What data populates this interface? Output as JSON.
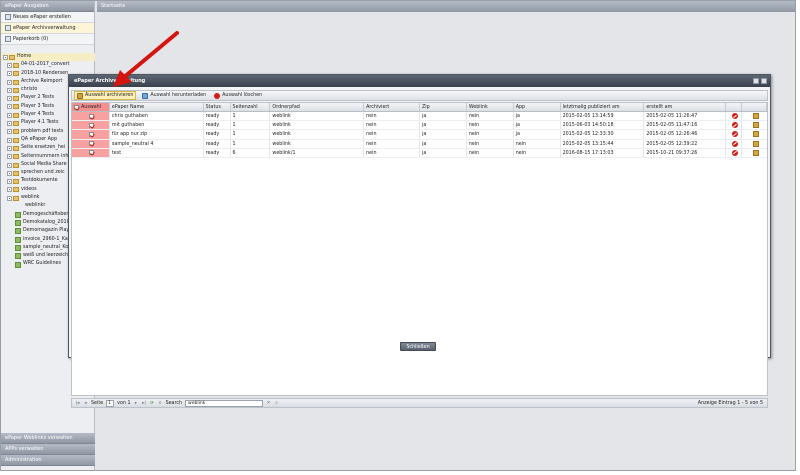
{
  "sidebar": {
    "top_header": "ePaper Ausgaben",
    "menu": [
      {
        "label": "Neues ePaper erstellen"
      },
      {
        "label": "ePaper Archivverwaltung"
      },
      {
        "label": "Papierkorb (0)"
      }
    ],
    "tree": [
      {
        "label": "Home",
        "type": "home"
      },
      {
        "label": "04-01-2017_convert",
        "type": "folder"
      },
      {
        "label": "2018-10 Rendersen",
        "type": "folder"
      },
      {
        "label": "Archive Reimport",
        "type": "folder"
      },
      {
        "label": "christo",
        "type": "folder"
      },
      {
        "label": "Player 2 Tests",
        "type": "folder"
      },
      {
        "label": "Player 3 Tests",
        "type": "folder"
      },
      {
        "label": "Player 4 Tests",
        "type": "folder"
      },
      {
        "label": "Player 4.1 Tests",
        "type": "folder"
      },
      {
        "label": "problem pdf tests",
        "type": "folder"
      },
      {
        "label": "QA ePaper App",
        "type": "folder"
      },
      {
        "label": "Seite ersetzen_hei",
        "type": "folder"
      },
      {
        "label": "Seitennummern inh",
        "type": "folder"
      },
      {
        "label": "Social Media Share",
        "type": "folder"
      },
      {
        "label": "sprechen und zeic",
        "type": "folder"
      },
      {
        "label": "Testdokumente",
        "type": "folder"
      },
      {
        "label": "videos",
        "type": "folder"
      },
      {
        "label": "weblink",
        "type": "folder"
      },
      {
        "label": "weblinkr",
        "type": "plain"
      },
      {
        "label": "Demogeschäftsber",
        "type": "doc"
      },
      {
        "label": "Demokatalog_2010",
        "type": "doc"
      },
      {
        "label": "Demomagazin Play",
        "type": "doc"
      },
      {
        "label": "invoice_2960-1_Ka",
        "type": "doc"
      },
      {
        "label": "sample_neutral_Ko",
        "type": "doc"
      },
      {
        "label": "weiß und leerzeich",
        "type": "doc"
      },
      {
        "label": "WRC Guidelines",
        "type": "doc"
      }
    ],
    "bottom": [
      {
        "label": "ePaper Weblinks verwalten"
      },
      {
        "label": "APPs verwalten"
      },
      {
        "label": "Administration"
      }
    ]
  },
  "main": {
    "header": "Startseite"
  },
  "dialog": {
    "title": "ePaper Archivverwaltung",
    "toolbar": {
      "archive": "Auswahl archivieren",
      "download": "Auswahl herunterladen",
      "delete": "Auswahl löschen"
    },
    "columns": {
      "check": "Auswahl",
      "name": "ePaper Name",
      "status": "Status",
      "pages": "Seitenzahl",
      "folder": "Ordnerpfad",
      "archived": "Archiviert",
      "zip": "Zip",
      "weblink": "Weblink",
      "app": "App",
      "last_published": "letztmalig publiziert am",
      "created": "erstellt am"
    },
    "rows": [
      {
        "name": "chris guthaben",
        "status": "ready",
        "pages": "1",
        "folder": "weblink",
        "archived": "nein",
        "zip": "ja",
        "weblink": "nein",
        "app": "ja",
        "last_published": "2015-02-05 13:14:59",
        "created": "2015-02-05 11:26:47"
      },
      {
        "name": "mit guthaben",
        "status": "ready",
        "pages": "1",
        "folder": "weblink",
        "archived": "nein",
        "zip": "ja",
        "weblink": "nein",
        "app": "ja",
        "last_published": "2015-06-03 14:50:18",
        "created": "2015-02-05 11:47:16"
      },
      {
        "name": "für app nur zip",
        "status": "ready",
        "pages": "1",
        "folder": "weblink",
        "archived": "nein",
        "zip": "ja",
        "weblink": "nein",
        "app": "ja",
        "last_published": "2015-02-05 12:33:30",
        "created": "2015-02-05 12:26:46"
      },
      {
        "name": "sample_neutral 4",
        "status": "ready",
        "pages": "1",
        "folder": "weblink",
        "archived": "nein",
        "zip": "ja",
        "weblink": "nein",
        "app": "nein",
        "last_published": "2015-02-05 13:15:44",
        "created": "2015-02-05 12:39:22"
      },
      {
        "name": "test",
        "status": "ready",
        "pages": "6",
        "folder": "weblink/1",
        "archived": "nein",
        "zip": "ja",
        "weblink": "nein",
        "app": "nein",
        "last_published": "2016-08-15 17:13:03",
        "created": "2015-10-21 09:37:26"
      }
    ],
    "pager": {
      "page_label": "Seite",
      "page_value": "1",
      "of_label": "von 1",
      "search_label": "Search",
      "search_value": "weblink",
      "info": "Anzeige Eintrag 1 - 5 von 5"
    },
    "close": "Schließen"
  },
  "colors": {
    "selection_highlight": "#f7a1a1",
    "annotation_arrow": "#d4140f",
    "header_gradient": "#8e97a3"
  }
}
